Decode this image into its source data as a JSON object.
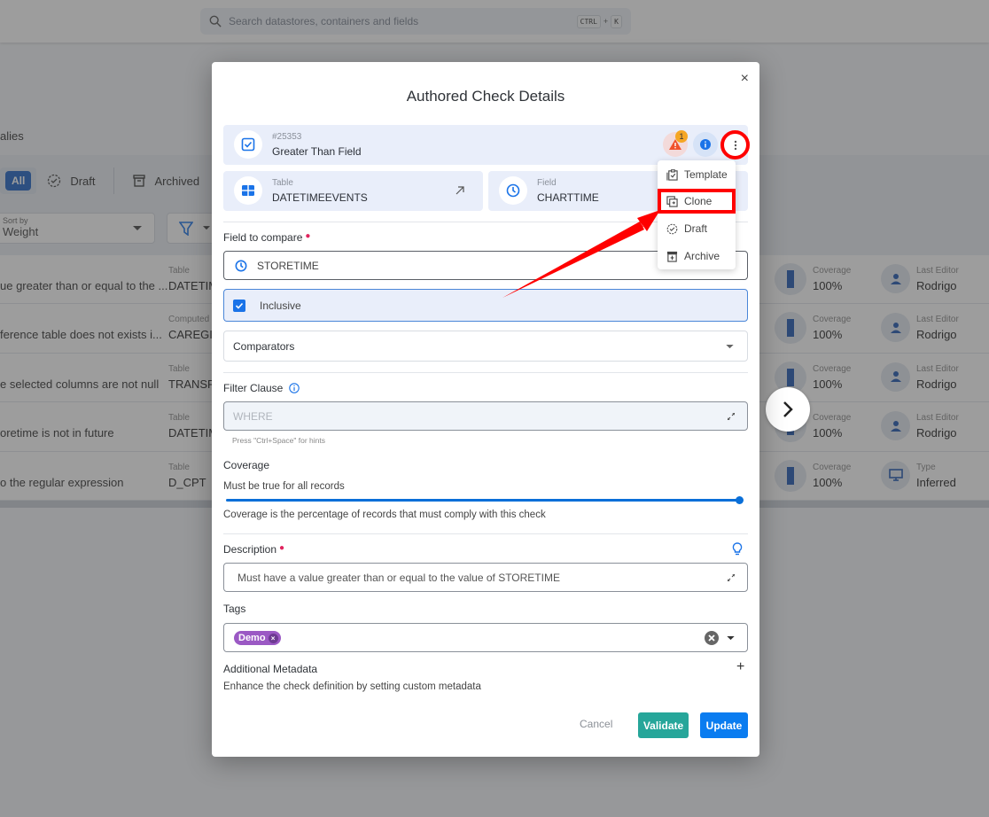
{
  "topbar": {
    "search_placeholder": "Search datastores, containers and fields",
    "shortcut_key1": "CTRL",
    "shortcut_plus": "+",
    "shortcut_key2": "K"
  },
  "background": {
    "section_label": "alies",
    "status_tabs": [
      {
        "label": "All",
        "active": true
      },
      {
        "label": "Draft"
      },
      {
        "label": "Archived"
      }
    ],
    "sort": {
      "label": "Sort by",
      "value": "Weight"
    },
    "rows": [
      {
        "desc": "ue greater than or equal to the ...",
        "container_label": "Table",
        "container": "DATETIM",
        "coverage_label": "Coverage",
        "coverage": "100%",
        "meta_label": "Last Editor",
        "meta": "Rodrigo",
        "meta_icon": "person-icon"
      },
      {
        "desc": "ference table does not exists i...",
        "container_label": "Computed",
        "container": "CAREGIV",
        "coverage_label": "Coverage",
        "coverage": "100%",
        "meta_label": "Last Editor",
        "meta": "Rodrigo",
        "meta_icon": "person-icon"
      },
      {
        "desc": "e selected columns are not null",
        "container_label": "Table",
        "container": "TRANSFE",
        "coverage_label": "Coverage",
        "coverage": "100%",
        "meta_label": "Last Editor",
        "meta": "Rodrigo",
        "meta_icon": "person-icon"
      },
      {
        "desc": "oretime is not in future",
        "container_label": "Table",
        "container": "DATETIM",
        "coverage_label": "Coverage",
        "coverage": "100%",
        "meta_label": "Last Editor",
        "meta": "Rodrigo",
        "meta_icon": "person-icon"
      },
      {
        "desc": "o the regular expression",
        "container_label": "Table",
        "container": "D_CPT",
        "coverage_label": "Coverage",
        "coverage": "100%",
        "meta_label": "Type",
        "meta": "Inferred",
        "meta_icon": "monitor-icon"
      }
    ]
  },
  "modal": {
    "title": "Authored Check Details",
    "close": "×",
    "check": {
      "id": "#25353",
      "name": "Greater Than Field",
      "alert_count": "1"
    },
    "table_card": {
      "label": "Table",
      "value": "DATETIMEEVENTS"
    },
    "field_card": {
      "label": "Field",
      "value": "CHARTTIME"
    },
    "field_to_compare": {
      "label": "Field to compare",
      "value": "STORETIME"
    },
    "inclusive": {
      "label": "Inclusive",
      "checked": true
    },
    "comparators": {
      "label": "Comparators"
    },
    "filter_clause": {
      "label": "Filter Clause",
      "placeholder": "WHERE",
      "hint": "Press \"Ctrl+Space\" for hints"
    },
    "coverage": {
      "label": "Coverage",
      "caption": "Must be true for all records",
      "value_percent": 100,
      "help": "Coverage is the percentage of records that must comply with this check"
    },
    "description": {
      "label": "Description",
      "value": "Must have a value greater than or equal to the value of STORETIME"
    },
    "tags": {
      "label": "Tags",
      "items": [
        "Demo"
      ]
    },
    "metadata": {
      "label": "Additional Metadata",
      "help": "Enhance the check definition by setting custom metadata",
      "add": "+"
    },
    "buttons": {
      "cancel": "Cancel",
      "validate": "Validate",
      "update": "Update"
    }
  },
  "menu": {
    "items": [
      {
        "label": "Template",
        "icon": "clipboard-check-icon"
      },
      {
        "label": "Clone",
        "icon": "clone-icon",
        "highlighted": true
      },
      {
        "label": "Draft",
        "icon": "draft-circle-icon"
      },
      {
        "label": "Archive",
        "icon": "archive-icon"
      }
    ]
  },
  "colors": {
    "primary": "#0a7cf0",
    "validate": "#26a69a",
    "tag": "#9b59c4",
    "annotation": "#ff0000",
    "required": "#e0245e"
  }
}
